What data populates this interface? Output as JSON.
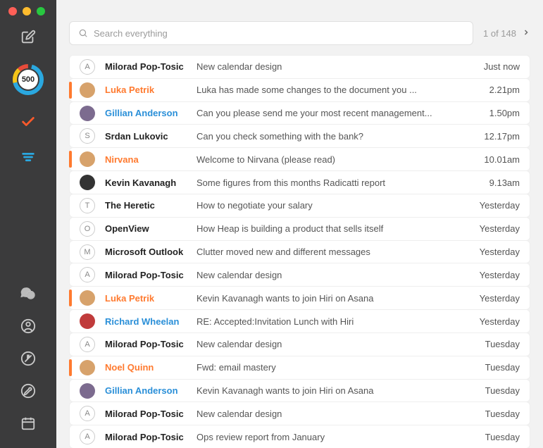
{
  "search": {
    "placeholder": "Search everything"
  },
  "pager": {
    "text": "1 of 148"
  },
  "sidebar": {
    "score": "500",
    "icons": {
      "compose": "compose",
      "dashboard": "dashboard",
      "tasks": "tasks",
      "filter": "filter",
      "chat": "chat",
      "profile": "profile",
      "activity": "activity",
      "settings": "settings",
      "calendar": "calendar"
    }
  },
  "messages": [
    {
      "avatar_type": "letter",
      "avatar": "A",
      "avatar_color": "#ccc",
      "sender": "Milorad Pop-Tosic",
      "sender_style": "bold",
      "subject": "New calendar design",
      "time": "Just now",
      "flag": false
    },
    {
      "avatar_type": "photo",
      "avatar": "",
      "avatar_color": "#d7a26b",
      "sender": "Luka Petrik",
      "sender_style": "orange",
      "subject": "Luka has made some changes to the document you ...",
      "time": "2.21pm",
      "flag": true
    },
    {
      "avatar_type": "photo",
      "avatar": "",
      "avatar_color": "#7c6b8f",
      "sender": "Gillian Anderson",
      "sender_style": "blue",
      "subject": "Can you please send me your most recent management...",
      "time": "1.50pm",
      "flag": false
    },
    {
      "avatar_type": "letter",
      "avatar": "S",
      "avatar_color": "#ccc",
      "sender": "Srdan Lukovic",
      "sender_style": "bold",
      "subject": "Can you check something with the bank?",
      "time": "12.17pm",
      "flag": false
    },
    {
      "avatar_type": "photo",
      "avatar": "",
      "avatar_color": "#d7a26b",
      "sender": "Nirvana",
      "sender_style": "orange",
      "subject": "Welcome to Nirvana (please read)",
      "time": "10.01am",
      "flag": true
    },
    {
      "avatar_type": "photo",
      "avatar": "",
      "avatar_color": "#333",
      "sender": "Kevin Kavanagh",
      "sender_style": "bold",
      "subject": "Some figures from this months Radicatti report",
      "time": "9.13am",
      "flag": false
    },
    {
      "avatar_type": "letter",
      "avatar": "T",
      "avatar_color": "#ccc",
      "sender": "The Heretic",
      "sender_style": "bold",
      "subject": "How to negotiate your salary",
      "time": "Yesterday",
      "flag": false
    },
    {
      "avatar_type": "letter",
      "avatar": "O",
      "avatar_color": "#ccc",
      "sender": "OpenView",
      "sender_style": "bold",
      "subject": "How Heap is building a product that sells itself",
      "time": "Yesterday",
      "flag": false
    },
    {
      "avatar_type": "letter",
      "avatar": "M",
      "avatar_color": "#ccc",
      "sender": "Microsoft Outlook",
      "sender_style": "bold",
      "subject": "Clutter moved new and different messages",
      "time": "Yesterday",
      "flag": false
    },
    {
      "avatar_type": "letter",
      "avatar": "A",
      "avatar_color": "#ccc",
      "sender": "Milorad Pop-Tosic",
      "sender_style": "bold",
      "subject": "New calendar design",
      "time": "Yesterday",
      "flag": false
    },
    {
      "avatar_type": "photo",
      "avatar": "",
      "avatar_color": "#d7a26b",
      "sender": "Luka Petrik",
      "sender_style": "orange",
      "subject": "Kevin Kavanagh wants to join Hiri on Asana",
      "time": "Yesterday",
      "flag": true
    },
    {
      "avatar_type": "photo",
      "avatar": "",
      "avatar_color": "#c03b3b",
      "sender": "Richard Wheelan",
      "sender_style": "blue",
      "subject": "RE: Accepted:Invitation Lunch with Hiri",
      "time": "Yesterday",
      "flag": false
    },
    {
      "avatar_type": "letter",
      "avatar": "A",
      "avatar_color": "#ccc",
      "sender": "Milorad Pop-Tosic",
      "sender_style": "bold",
      "subject": "New calendar design",
      "time": "Tuesday",
      "flag": false
    },
    {
      "avatar_type": "photo",
      "avatar": "",
      "avatar_color": "#d7a26b",
      "sender": "Noel Quinn",
      "sender_style": "orange",
      "subject": "Fwd: email mastery",
      "time": "Tuesday",
      "flag": true
    },
    {
      "avatar_type": "photo",
      "avatar": "",
      "avatar_color": "#7c6b8f",
      "sender": "Gillian Anderson",
      "sender_style": "blue",
      "subject": "Kevin Kavanagh wants to join Hiri on Asana",
      "time": "Tuesday",
      "flag": false
    },
    {
      "avatar_type": "letter",
      "avatar": "A",
      "avatar_color": "#ccc",
      "sender": "Milorad Pop-Tosic",
      "sender_style": "bold",
      "subject": "New calendar design",
      "time": "Tuesday",
      "flag": false
    },
    {
      "avatar_type": "letter",
      "avatar": "A",
      "avatar_color": "#ccc",
      "sender": "Milorad Pop-Tosic",
      "sender_style": "bold",
      "subject": "Ops review report from January",
      "time": "Tuesday",
      "flag": false
    }
  ]
}
